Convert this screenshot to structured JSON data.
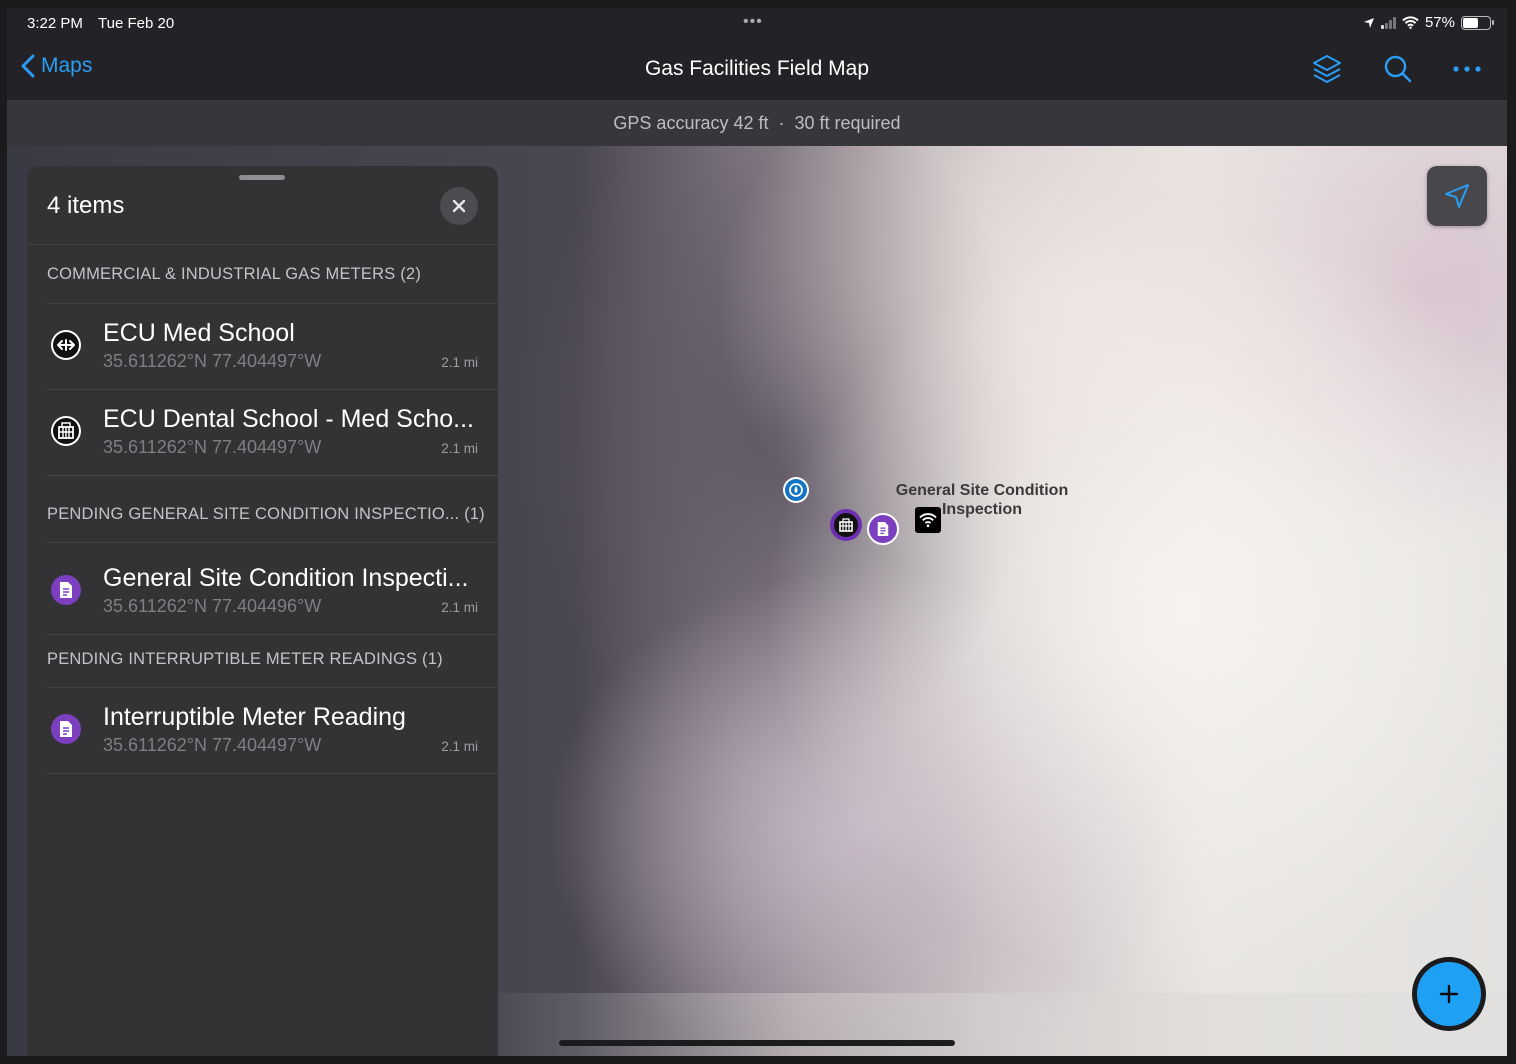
{
  "status_bar": {
    "time": "3:22 PM",
    "date": "Tue Feb 20",
    "multitask_dots": "•••",
    "battery_percent": "57%",
    "battery_level": 0.57
  },
  "nav": {
    "back_label": "Maps",
    "title": "Gas Facilities Field Map",
    "icons": [
      "layers-icon",
      "search-icon",
      "more-icon"
    ]
  },
  "gps": {
    "accuracy": "GPS accuracy 42 ft",
    "separator": "·",
    "required": "30 ft required"
  },
  "panel": {
    "title": "4 items",
    "sections": [
      {
        "header": "COMMERCIAL & INDUSTRIAL GAS METERS (2)",
        "items": [
          {
            "title": "ECU Med School",
            "coords": "35.611262°N  77.404497°W",
            "distance": "2.1 mi",
            "icon": "meter-arrows-icon"
          },
          {
            "title": "ECU Dental School - Med Scho...",
            "coords": "35.611262°N  77.404497°W",
            "distance": "2.1 mi",
            "icon": "building-icon"
          }
        ]
      },
      {
        "header": "PENDING GENERAL SITE CONDITION INSPECTIO... (1)",
        "items": [
          {
            "title": "General Site Condition Inspecti...",
            "coords": "35.611262°N  77.404496°W",
            "distance": "2.1 mi",
            "icon": "document-icon"
          }
        ]
      },
      {
        "header": "PENDING INTERRUPTIBLE METER READINGS (1)",
        "items": [
          {
            "title": "Interruptible Meter Reading",
            "coords": "35.611262°N  77.404497°W",
            "distance": "2.1 mi",
            "icon": "document-icon"
          }
        ]
      }
    ]
  },
  "map": {
    "label": "General Site Condition Inspection"
  },
  "colors": {
    "accent": "#2a9df4",
    "fab": "#1ea1f5",
    "purple": "#7c3fbf",
    "panel": "#333336"
  }
}
